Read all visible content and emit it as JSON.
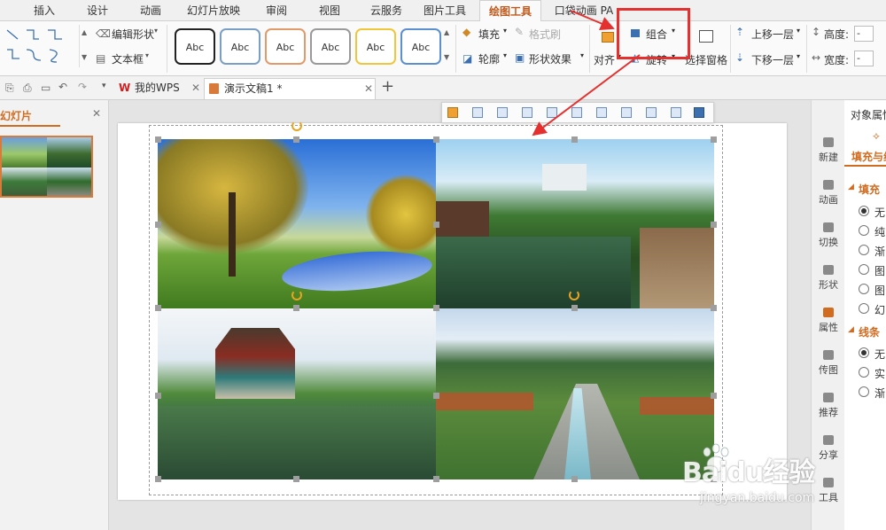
{
  "ribbon_tabs": [
    "插入",
    "设计",
    "动画",
    "幻灯片放映",
    "审阅",
    "视图",
    "云服务",
    "图片工具",
    "绘图工具",
    "口袋动画 PA"
  ],
  "active_tab": "绘图工具",
  "ribbon": {
    "edit_shape": "编辑形状",
    "text_box": "文本框",
    "style_sample": "Abc",
    "fill": "填充",
    "format_painter": "格式刷",
    "outline": "轮廓",
    "shape_effects": "形状效果",
    "group": "组合",
    "align": "对齐",
    "rotate": "旋转",
    "selection_pane": "选择窗格",
    "bring_forward": "上移一层",
    "send_backward": "下移一层",
    "height": "高度:",
    "width": "宽度:",
    "height_value": "-",
    "width_value": "-"
  },
  "style_colors": [
    "#222222",
    "#7a9fc4",
    "#e29a6a",
    "#9a9a9a",
    "#f0c63a",
    "#5b8fd0"
  ],
  "doc_tabs": [
    {
      "label": "我的WPS"
    },
    {
      "label": "演示文稿1 *"
    }
  ],
  "left_panel": {
    "title": "幻灯片"
  },
  "right_rail": [
    "新建",
    "动画",
    "切换",
    "形状",
    "属性",
    "传图",
    "推荐",
    "分享",
    "工具"
  ],
  "props_panel": {
    "title": "对象属性",
    "tab": "填充与线条",
    "fill_section": "填充",
    "fill_options": [
      "无",
      "纯",
      "渐",
      "图",
      "图",
      "幻"
    ],
    "line_section": "线条",
    "line_options": [
      "无",
      "实",
      "渐"
    ]
  },
  "accent_color": "#d16b20",
  "annotation_color": "#e53030",
  "watermark": {
    "brand": "Baidu经验",
    "url": "jingyan.baidu.com"
  }
}
